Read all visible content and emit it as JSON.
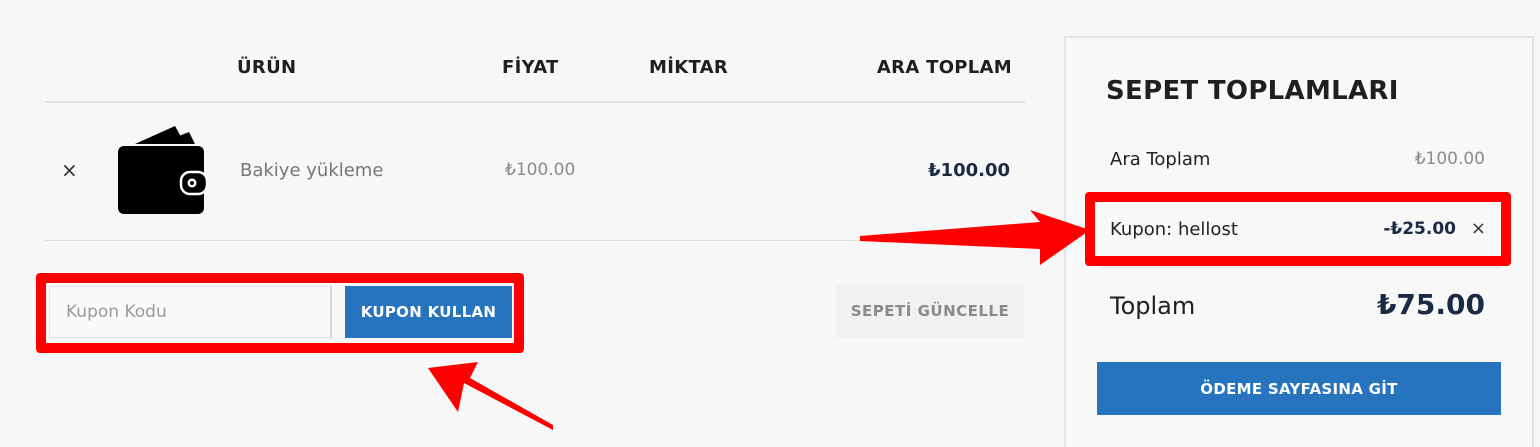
{
  "cart": {
    "headers": {
      "product": "ÜRÜN",
      "price": "FİYAT",
      "quantity": "MİKTAR",
      "subtotal": "ARA TOPLAM"
    },
    "items": [
      {
        "remove": "×",
        "icon": "wallet-icon",
        "name": "Bakiye yükleme",
        "price": "₺100.00",
        "subtotal": "₺100.00"
      }
    ],
    "coupon": {
      "placeholder": "Kupon Kodu",
      "value": "",
      "apply_label": "KUPON KULLAN"
    },
    "update_label": "SEPETİ GÜNCELLE"
  },
  "totals": {
    "title": "SEPET TOPLAMLARI",
    "subtotal_label": "Ara Toplam",
    "subtotal_value": "₺100.00",
    "coupon_label": "Kupon: hellost",
    "coupon_value": "-₺25.00",
    "coupon_remove": "×",
    "total_label": "Toplam",
    "total_value": "₺75.00",
    "checkout_label": "ÖDEME SAYFASINA GİT"
  },
  "colors": {
    "accent": "#2673be",
    "annotation": "#ff0000",
    "price_dark": "#1b2a44",
    "background": "#f7f7f7"
  }
}
